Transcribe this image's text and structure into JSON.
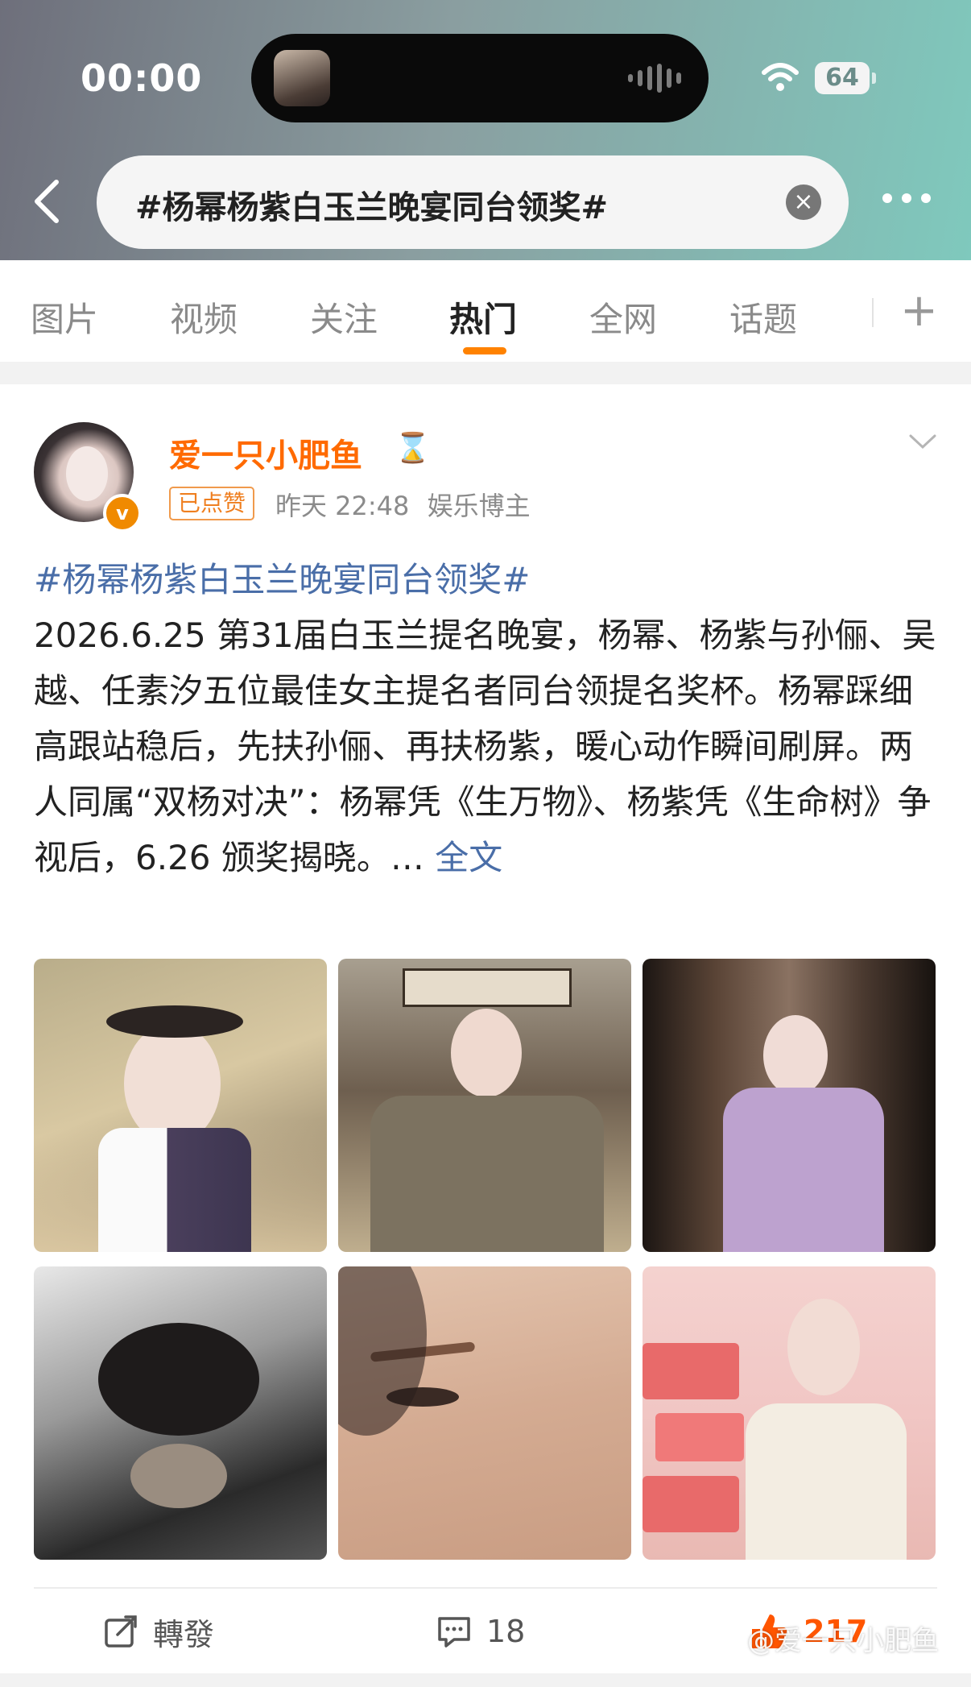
{
  "status_bar": {
    "time": "00:00",
    "battery": "64"
  },
  "header": {
    "search_text": "#杨幂杨紫白玉兰晚宴同台领奖#"
  },
  "tabs": [
    {
      "label": "图片"
    },
    {
      "label": "视频"
    },
    {
      "label": "关注"
    },
    {
      "label": "热门",
      "active": true
    },
    {
      "label": "全网"
    },
    {
      "label": "话题"
    }
  ],
  "post": {
    "username": "爱一只小肥鱼",
    "liked_badge": "已点赞",
    "time": "昨天 22:48",
    "category": "娱乐博主",
    "hashtag": "#杨幂杨紫白玉兰晚宴同台领奖#",
    "body": "2026.6.25 第31届白玉兰提名晚宴，杨幂、杨紫与孙俪、吴越、任素汐五位最佳女主提名者同台领提名奖杯。杨幂踩细高跟站稳后，先扶孙俪、再扶杨紫，暖心动作瞬间刷屏。两人同属“双杨对决”：杨幂凭《生万物》、杨紫凭《生命树》争视后，6.26 颁奖揭晓。… ",
    "full_text_link": "全文",
    "images": [
      {
        "name": "photo-hat-braids"
      },
      {
        "name": "photo-shop-sign"
      },
      {
        "name": "photo-corridor-costume"
      },
      {
        "name": "photo-cat-hug"
      },
      {
        "name": "photo-face-closeup"
      },
      {
        "name": "photo-clocks"
      }
    ],
    "actions": {
      "repost_label": "轉發",
      "comment_count": "18",
      "like_count": "217"
    },
    "watermark": "@爱一只小肥鱼"
  },
  "colors": {
    "accent": "#ff8200",
    "username": "#ff6a00",
    "link": "#4a6ea8",
    "like": "#ff5500"
  }
}
